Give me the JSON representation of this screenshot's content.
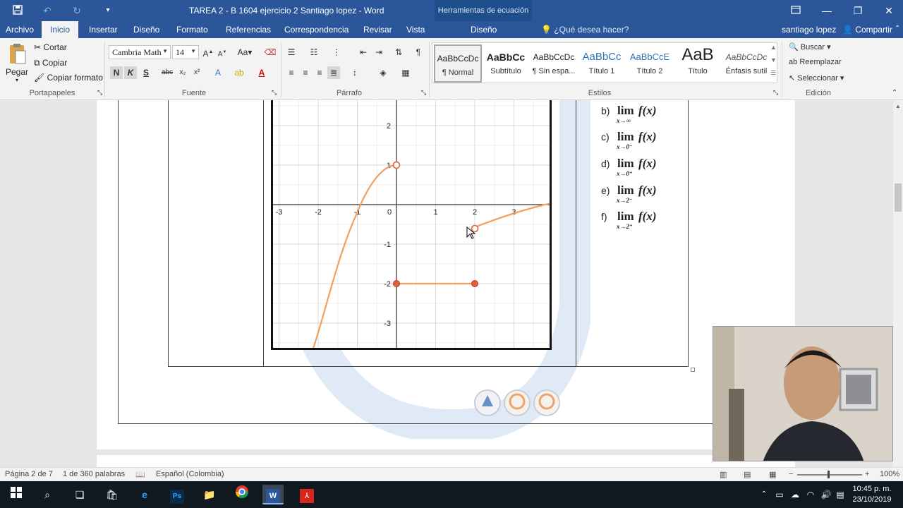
{
  "window": {
    "title": "TAREA 2 - B  1604 ejercicio 2 Santiago lopez - Word",
    "context_title": "Herramientas de ecuación"
  },
  "tabs": [
    {
      "label": "Archivo"
    },
    {
      "label": "Inicio"
    },
    {
      "label": "Insertar"
    },
    {
      "label": "Diseño"
    },
    {
      "label": "Formato"
    },
    {
      "label": "Referencias"
    },
    {
      "label": "Correspondencia"
    },
    {
      "label": "Revisar"
    },
    {
      "label": "Vista"
    },
    {
      "label": "Diseño"
    }
  ],
  "tell_me": "¿Qué desea hacer?",
  "user": "santiago lopez",
  "share": "Compartir",
  "ribbon": {
    "clipboard": {
      "paste": "Pegar",
      "cut": "Cortar",
      "copy": "Copiar",
      "format_painter": "Copiar formato",
      "label": "Portapapeles"
    },
    "font": {
      "family": "Cambria Math",
      "size": "14",
      "label": "Fuente",
      "bold": "N",
      "italic": "K",
      "underline": "S",
      "strike": "abc"
    },
    "paragraph": {
      "label": "Párrafo"
    },
    "styles": {
      "label": "Estilos",
      "items": [
        {
          "preview": "AaBbCcDc",
          "name": "¶ Normal"
        },
        {
          "preview": "AaBbCc",
          "name": "Subtítulo"
        },
        {
          "preview": "AaBbCcDc",
          "name": "¶ Sin espa..."
        },
        {
          "preview": "AaBbCc",
          "name": "Título 1"
        },
        {
          "preview": "AaBbCcE",
          "name": "Título 2"
        },
        {
          "preview": "AaB",
          "name": "Título"
        },
        {
          "preview": "AaBbCcDc",
          "name": "Énfasis sutil"
        }
      ]
    },
    "editing": {
      "find": "Buscar",
      "replace": "Reemplazar",
      "select": "Seleccionar",
      "label": "Edición"
    }
  },
  "graph": {
    "x_ticks": [
      "-3",
      "-2",
      "-1",
      "0",
      "1",
      "2",
      "3"
    ],
    "y_ticks": [
      "2",
      "1",
      "-1",
      "-2",
      "-3"
    ]
  },
  "limits": {
    "lim": "lim",
    "fx": "f(x)",
    "items": [
      {
        "letter": "b)",
        "sub": "x→∞"
      },
      {
        "letter": "c)",
        "sub": "x→0⁻"
      },
      {
        "letter": "d)",
        "sub": "x→0⁺"
      },
      {
        "letter": "e)",
        "sub": "x→2⁻"
      },
      {
        "letter": "f)",
        "sub": "x→2⁺"
      }
    ]
  },
  "status": {
    "page": "Página 2 de 7",
    "words": "1 de 360 palabras",
    "language": "Español (Colombia)",
    "zoom": "100%"
  },
  "taskbar": {
    "time": "10:45 p. m.",
    "date": "23/10/2019"
  },
  "colors": {
    "word_blue": "#2b579a",
    "curve_orange": "#f0a060",
    "point_red": "#e0603a"
  }
}
